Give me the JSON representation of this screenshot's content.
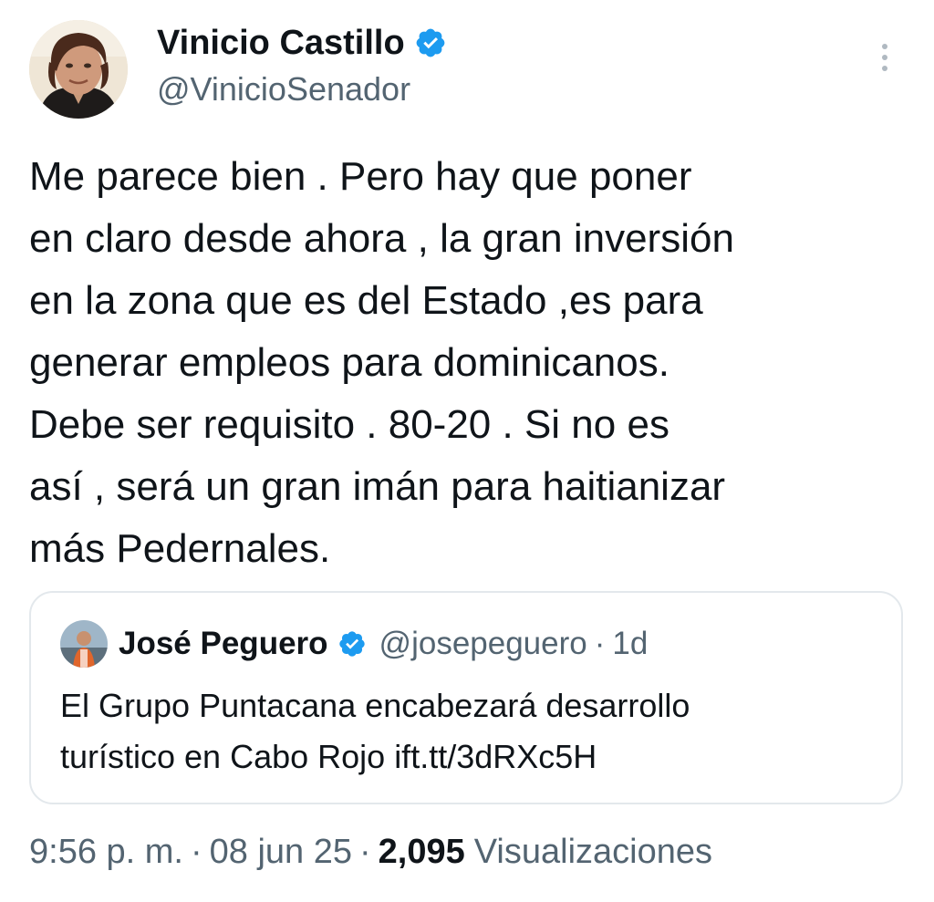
{
  "author": {
    "display_name": "Vinicio Castillo",
    "handle": "@VinicioSenador",
    "verified": true,
    "avatar_icon": "profile-photo"
  },
  "tweet": {
    "text": "Me parece bien . Pero hay que poner\nen claro desde ahora , la gran inversión\nen la zona que es del Estado ,es para\ngenerar empleos para dominicanos.\nDebe ser requisito . 80-20 . Si no es\nasí , será un gran imán para haitianizar\nmás Pedernales."
  },
  "quoted_tweet": {
    "display_name": "José Peguero",
    "handle": "@josepeguero",
    "separator": "·",
    "time": "1d",
    "verified": true,
    "text": "El Grupo Puntacana encabezará desarrollo\nturístico en Cabo Rojo ift.tt/3dRXc5H"
  },
  "meta": {
    "time": "9:56 p. m.",
    "date": "08 jun 25",
    "separator": "·",
    "views_count": "2,095",
    "views_label": "Visualizaciones"
  },
  "icons": {
    "more": "more-vertical-icon",
    "verified": "verified-badge-icon"
  },
  "colors": {
    "primary_text": "#0f1419",
    "secondary_text": "#536471",
    "verified_blue": "#1d9bf0",
    "border": "#e3e8ec"
  }
}
